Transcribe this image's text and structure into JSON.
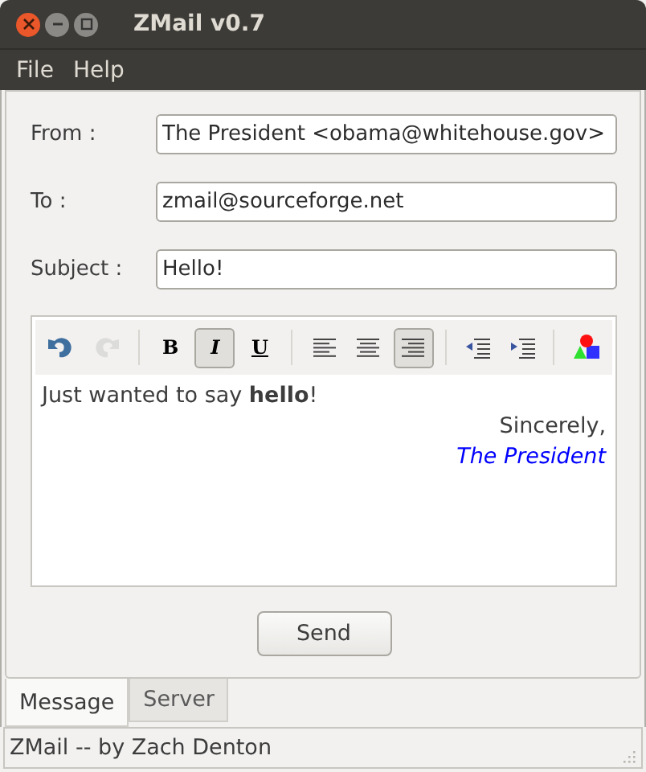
{
  "window": {
    "title": "ZMail v0.7"
  },
  "menu": [
    "File",
    "Help"
  ],
  "fields": [
    {
      "label": "From :",
      "value": "The President <obama@whitehouse.gov>"
    },
    {
      "label": "To :",
      "value": "zmail@sourceforge.net"
    },
    {
      "label": "Subject :",
      "value": "Hello!"
    }
  ],
  "toolbar": [
    {
      "kind": "undo",
      "disabled": false,
      "active": false
    },
    {
      "kind": "redo",
      "disabled": true,
      "active": false
    },
    {
      "kind": "separator"
    },
    {
      "kind": "bold",
      "label": "B",
      "disabled": false,
      "active": false
    },
    {
      "kind": "italic",
      "label": "I",
      "disabled": false,
      "active": true
    },
    {
      "kind": "underline",
      "label": "U",
      "disabled": false,
      "active": false
    },
    {
      "kind": "separator"
    },
    {
      "kind": "align-left",
      "disabled": false,
      "active": false
    },
    {
      "kind": "align-center",
      "disabled": false,
      "active": false
    },
    {
      "kind": "align-right",
      "disabled": false,
      "active": true
    },
    {
      "kind": "separator"
    },
    {
      "kind": "outdent",
      "disabled": false,
      "active": false
    },
    {
      "kind": "indent",
      "disabled": false,
      "active": false
    },
    {
      "kind": "separator"
    },
    {
      "kind": "color",
      "disabled": false,
      "active": false
    }
  ],
  "body": [
    {
      "text": "Just wanted to say **hello**!",
      "right_aligned": false,
      "italic": false,
      "color": "#3c3c3c"
    },
    {
      "text": "Sincerely,",
      "right_aligned": true,
      "italic": false,
      "color": "#3c3c3c"
    },
    {
      "text": "The President",
      "right_aligned": true,
      "italic": true,
      "color": "#0000ff"
    }
  ],
  "send_button": "Send",
  "tabs": [
    {
      "label": "Message",
      "selected": true
    },
    {
      "label": "Server",
      "selected": false
    }
  ],
  "status_bar": "ZMail -- by Zach Denton"
}
